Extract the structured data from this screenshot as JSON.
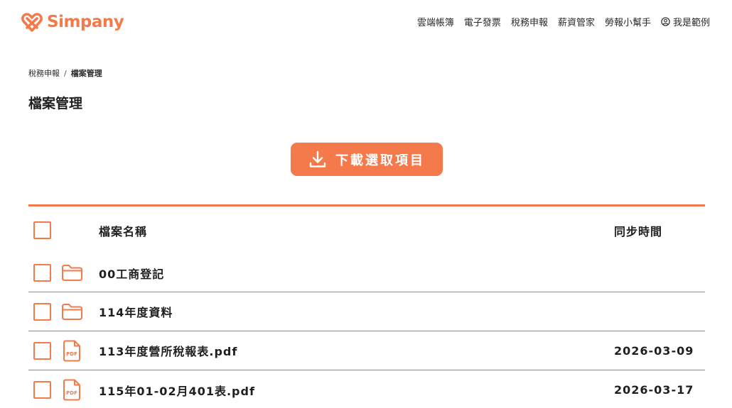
{
  "brand": {
    "name": "Simpany",
    "accent_color": "#f37a4a",
    "logo_icon": "heart-logo-icon"
  },
  "nav": {
    "items": [
      "雲端帳簿",
      "電子發票",
      "稅務申報",
      "薪資管家",
      "勞報小幫手"
    ],
    "user_label": "我是範例",
    "user_icon": "user-circle-icon"
  },
  "breadcrumb": {
    "parent": "稅務申報",
    "separator": "/",
    "current": "檔案管理"
  },
  "page": {
    "title": "檔案管理"
  },
  "actions": {
    "download_label": "下載選取項目",
    "download_icon": "download-icon"
  },
  "table": {
    "columns": {
      "name": "檔案名稱",
      "sync_time": "同步時間"
    },
    "rows": [
      {
        "type": "folder",
        "icon": "folder-icon",
        "name": "00工商登記",
        "sync_time": ""
      },
      {
        "type": "folder",
        "icon": "folder-icon",
        "name": "114年度資料",
        "sync_time": ""
      },
      {
        "type": "pdf",
        "icon": "pdf-file-icon",
        "name": "113年度營所稅報表.pdf",
        "sync_time": "2026-03-09",
        "icon_text": "PDF"
      },
      {
        "type": "pdf",
        "icon": "pdf-file-icon",
        "name": "115年01-02月401表.pdf",
        "sync_time": "2026-03-17",
        "icon_text": "PDF"
      }
    ]
  }
}
